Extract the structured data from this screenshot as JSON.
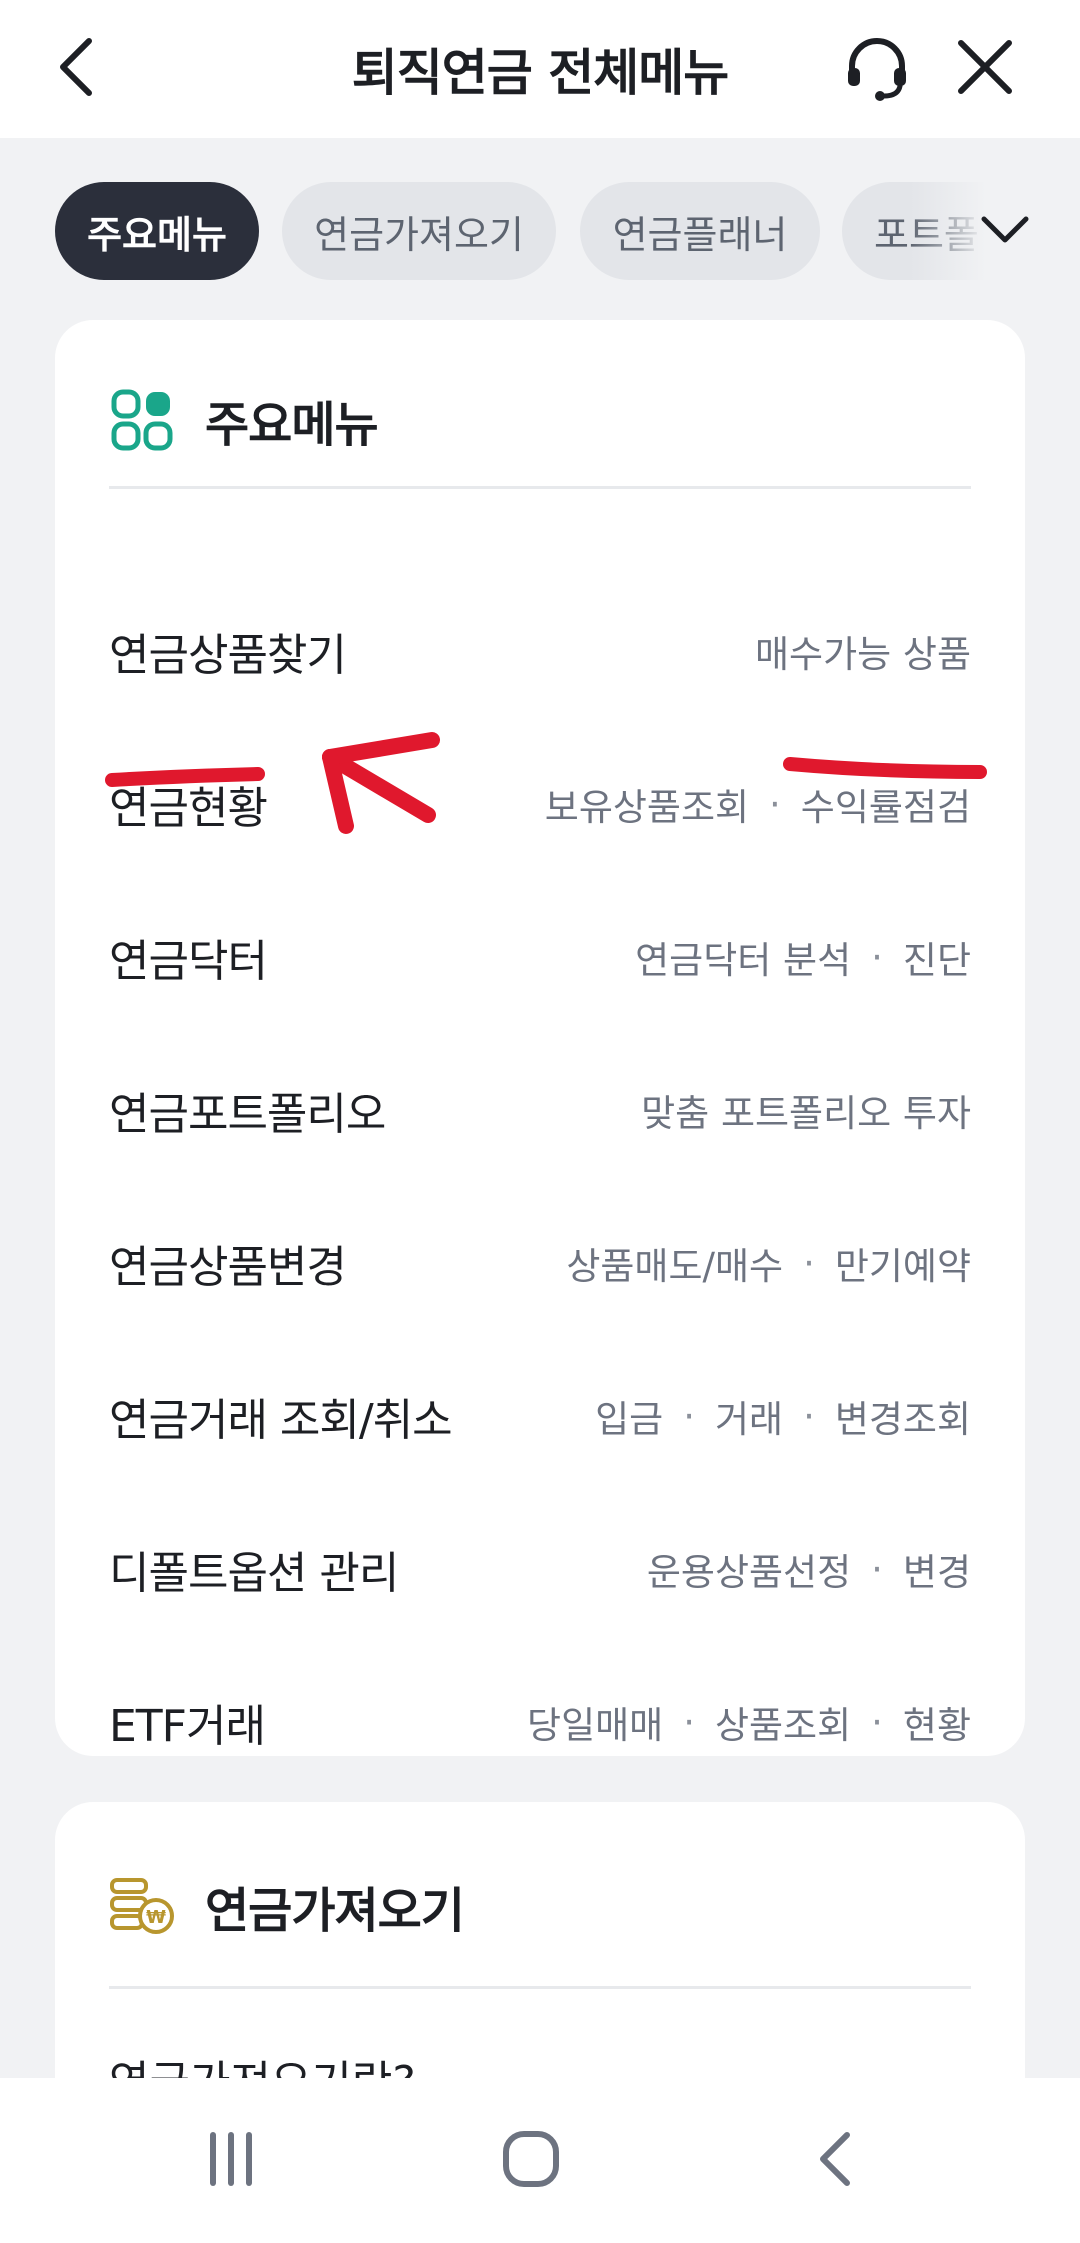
{
  "header": {
    "title": "퇴직연금 전체메뉴",
    "back_icon": "chevron-left-icon",
    "support_icon": "headset-icon",
    "close_icon": "close-icon"
  },
  "tabs": {
    "items": [
      {
        "label": "주요메뉴",
        "active": true
      },
      {
        "label": "연금가져오기",
        "active": false
      },
      {
        "label": "연금플래너",
        "active": false
      },
      {
        "label": "포트폴",
        "active": false
      }
    ],
    "expand_icon": "chevron-down-icon"
  },
  "main_card": {
    "title": "주요메뉴",
    "icon": "grid-icon",
    "accent_color": "#1aa68a",
    "rows": [
      {
        "label": "연금상품찾기",
        "subs": [
          "매수가능 상품"
        ]
      },
      {
        "label": "연금현황",
        "subs": [
          "보유상품조회",
          "수익률점검"
        ]
      },
      {
        "label": "연금닥터",
        "subs": [
          "연금닥터 분석",
          "진단"
        ]
      },
      {
        "label": "연금포트폴리오",
        "subs": [
          "맞춤 포트폴리오 투자"
        ]
      },
      {
        "label": "연금상품변경",
        "subs": [
          "상품매도/매수",
          "만기예약"
        ]
      },
      {
        "label": "연금거래 조회/취소",
        "subs": [
          "입금",
          "거래",
          "변경조회"
        ]
      },
      {
        "label": "디폴트옵션 관리",
        "subs": [
          "운용상품선정",
          "변경"
        ]
      },
      {
        "label": "ETF거래",
        "subs": [
          "당일매매",
          "상품조회",
          "현황"
        ]
      }
    ],
    "separator": "·"
  },
  "section_card": {
    "title": "연금가져오기",
    "icon": "coin-stack-icon",
    "accent_color": "#b8962e",
    "peek_text": "연금가져오기란?"
  },
  "annotation_color": "#e0182d",
  "navbar": {
    "recents_icon": "recent-apps-icon",
    "home_icon": "home-icon",
    "back_icon": "back-icon"
  }
}
